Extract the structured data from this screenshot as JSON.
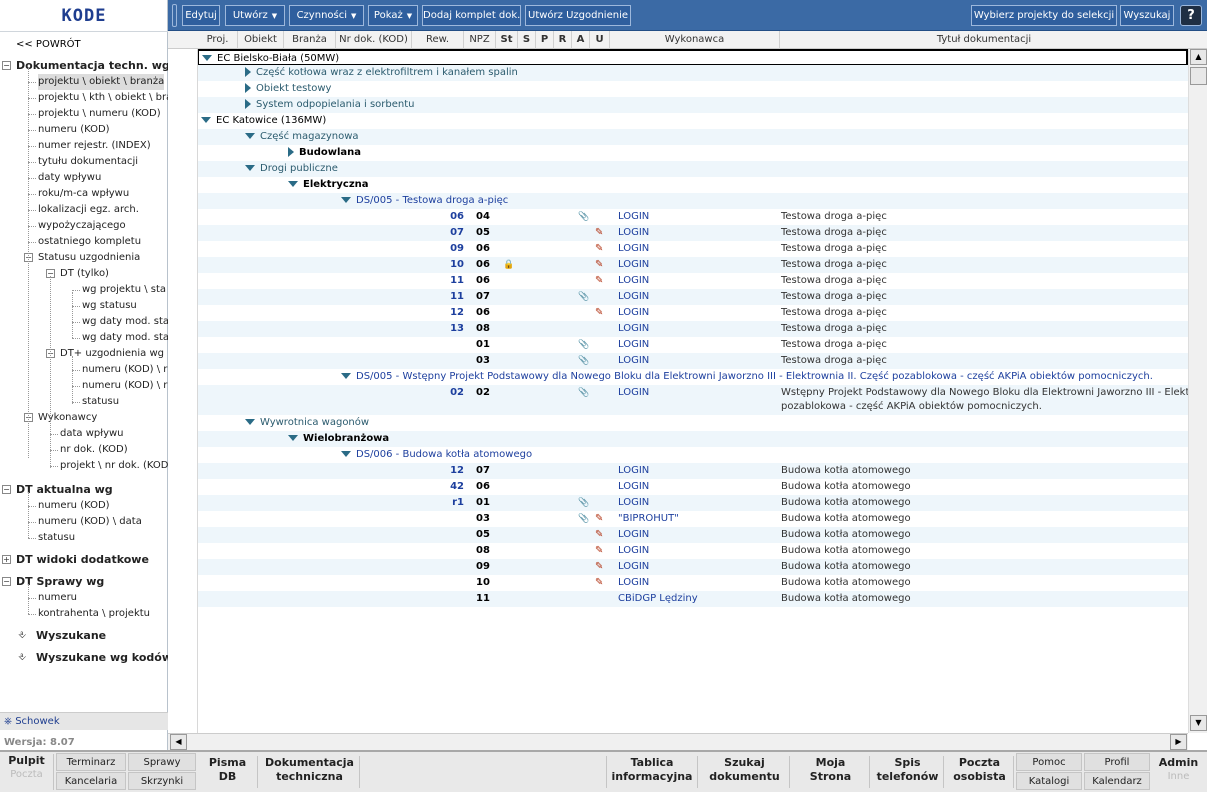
{
  "app": {
    "logo": "KODE",
    "back": "<< POWRÓT",
    "version": "Wersja: 8.07",
    "schowek": "Schowek"
  },
  "toolbar": {
    "edit": "Edytuj",
    "create": "Utwórz",
    "actions": "Czynności",
    "show": "Pokaż",
    "add_set": "Dodaj komplet dok.",
    "create_agreement": "Utwórz Uzgodnienie",
    "select_projects": "Wybierz projekty do selekcji",
    "search": "Wyszukaj",
    "help": "?"
  },
  "columns": {
    "proj": "Proj.",
    "obiekt": "Obiekt",
    "branza": "Branża",
    "nr_dok": "Nr dok. (KOD)",
    "rew": "Rew.",
    "npz": "NPZ",
    "st": "St",
    "s": "S",
    "p": "P",
    "r": "R",
    "a": "A",
    "u": "U",
    "wykonawca": "Wykonawca",
    "tytul": "Tytuł dokumentacji"
  },
  "sidebar": {
    "t0": "Dokumentacja techn. wg",
    "t1": "projektu \\ obiekt \\ branża",
    "t2": "projektu \\ kth \\ obiekt \\ bra",
    "t3": "projektu \\ numeru (KOD)",
    "t4": "numeru (KOD)",
    "t5": "numer rejestr. (INDEX)",
    "t6": "tytułu dokumentacji",
    "t7": "daty wpływu",
    "t8": "roku/m-ca wpływu",
    "t9": "lokalizacji egz. arch.",
    "t10": "wypożyczającego",
    "t11": "ostatniego kompletu",
    "t12": "Statusu uzgodnienia",
    "t13": "DT (tylko)",
    "t14": "wg projektu \\ sta",
    "t15": "wg statusu",
    "t16": "wg daty mod. sta",
    "t17": "wg daty mod. sta",
    "t18": "DT+ uzgodnienia wg",
    "t19": "numeru (KOD) \\ r",
    "t20": "numeru (KOD) \\ r",
    "t21": "statusu",
    "t22": "Wykonawcy",
    "t23": "data wpływu",
    "t24": "nr dok. (KOD)",
    "t25": "projekt \\ nr dok. (KOD",
    "t26": "DT aktualna wg",
    "t27": "numeru (KOD)",
    "t28": "numeru (KOD) \\ data",
    "t29": "statusu",
    "t30": "DT widoki dodatkowe",
    "t31": "DT Sprawy wg",
    "t32": "numeru",
    "t33": "kontrahenta \\ projektu",
    "t34": "Wyszukane",
    "t35": "Wyszukane wg kodów"
  },
  "tree": {
    "g1": "EC Bielsko-Biała (50MW)",
    "g1a": "Część kotłowa wraz z elektrofiltrem i kanałem spalin",
    "g1b": "Obiekt testowy",
    "g1c": "System odpopielania i sorbentu",
    "g2": "EC Katowice (136MW)",
    "g2a": "Część magazynowa",
    "g2a1": "Budowlana",
    "g2b": "Drogi publiczne",
    "g2b1": "Elektryczna",
    "d1": "DS/005 - Testowa droga a-pięc",
    "d2": "DS/005 - Wstępny Projekt Podstawowy dla Nowego Bloku dla Elektrowni Jaworzno III - Elektrownia II. Część pozablokowa - część AKPiA obiektów pomocniczych.",
    "g2c": "Wywrotnica wagonów",
    "g2c1": "Wielobranżowa",
    "d3": "DS/006 - Budowa kotła atomowego"
  },
  "docs1": [
    {
      "proj": "06",
      "rew": "04",
      "att": true,
      "edit": false,
      "lock": false,
      "wyk": "LOGIN",
      "tyt": "Testowa droga a-pięc"
    },
    {
      "proj": "07",
      "rew": "05",
      "att": false,
      "edit": true,
      "lock": false,
      "wyk": "LOGIN",
      "tyt": "Testowa droga a-pięc"
    },
    {
      "proj": "09",
      "rew": "06",
      "att": false,
      "edit": true,
      "lock": false,
      "wyk": "LOGIN",
      "tyt": "Testowa droga a-pięc"
    },
    {
      "proj": "10",
      "rew": "06",
      "att": false,
      "edit": true,
      "lock": true,
      "wyk": "LOGIN",
      "tyt": "Testowa droga a-pięc"
    },
    {
      "proj": "11",
      "rew": "06",
      "att": false,
      "edit": true,
      "lock": false,
      "wyk": "LOGIN",
      "tyt": "Testowa droga a-pięc"
    },
    {
      "proj": "11",
      "rew": "07",
      "att": true,
      "edit": false,
      "lock": false,
      "wyk": "LOGIN",
      "tyt": "Testowa droga a-pięc"
    },
    {
      "proj": "12",
      "rew": "06",
      "att": false,
      "edit": true,
      "lock": false,
      "wyk": "LOGIN",
      "tyt": "Testowa droga a-pięc"
    },
    {
      "proj": "13",
      "rew": "08",
      "att": false,
      "edit": false,
      "lock": false,
      "wyk": "LOGIN",
      "tyt": "Testowa droga a-pięc"
    },
    {
      "proj": "",
      "rew": "01",
      "att": true,
      "edit": false,
      "lock": false,
      "wyk": "LOGIN",
      "tyt": "Testowa droga a-pięc"
    },
    {
      "proj": "",
      "rew": "03",
      "att": true,
      "edit": false,
      "lock": false,
      "wyk": "LOGIN",
      "tyt": "Testowa droga a-pięc"
    }
  ],
  "docs2": {
    "proj": "02",
    "rew": "02",
    "wyk": "LOGIN",
    "tyt1": "Wstępny Projekt Podstawowy dla Nowego Bloku dla Elektrowni Jaworzno III - Elektr",
    "tyt2": "pozablokowa - część AKPiA obiektów pomocniczych."
  },
  "docs3": [
    {
      "proj": "12",
      "rew": "07",
      "att": false,
      "edit": false,
      "wyk": "LOGIN",
      "tyt": "Budowa kotła atomowego"
    },
    {
      "proj": "42",
      "rew": "06",
      "att": false,
      "edit": false,
      "wyk": "LOGIN",
      "tyt": "Budowa kotła atomowego"
    },
    {
      "proj": "r1",
      "rew": "01",
      "att": true,
      "edit": false,
      "wyk": "LOGIN",
      "tyt": "Budowa kotła atomowego"
    },
    {
      "proj": "",
      "rew": "03",
      "att": true,
      "edit": true,
      "wyk": "\"BIPROHUT\"",
      "tyt": "Budowa kotła atomowego"
    },
    {
      "proj": "",
      "rew": "05",
      "att": false,
      "edit": true,
      "wyk": "LOGIN",
      "tyt": "Budowa kotła atomowego"
    },
    {
      "proj": "",
      "rew": "08",
      "att": false,
      "edit": true,
      "wyk": "LOGIN",
      "tyt": "Budowa kotła atomowego"
    },
    {
      "proj": "",
      "rew": "09",
      "att": false,
      "edit": true,
      "wyk": "LOGIN",
      "tyt": "Budowa kotła atomowego"
    },
    {
      "proj": "",
      "rew": "10",
      "att": false,
      "edit": true,
      "wyk": "LOGIN",
      "tyt": "Budowa kotła atomowego"
    },
    {
      "proj": "",
      "rew": "11",
      "att": false,
      "edit": false,
      "wyk": "CBiDGP Lędziny",
      "tyt": "Budowa kotła atomowego"
    }
  ],
  "bottom": {
    "pulpit": "Pulpit",
    "pulpit_sub": "Poczta",
    "terminarz": "Terminarz",
    "kancelaria": "Kancelaria",
    "sprawy": "Sprawy",
    "skrzynki": "Skrzynki",
    "pisma1": "Pisma",
    "pisma2": "DB",
    "dok1": "Dokumentacja",
    "dok2": "techniczna",
    "tab1": "Tablica",
    "tab2": "informacyjna",
    "szu1": "Szukaj",
    "szu2": "dokumentu",
    "moja1": "Moja",
    "moja2": "Strona",
    "spis1": "Spis",
    "spis2": "telefonów",
    "pocz1": "Poczta",
    "pocz2": "osobista",
    "pomoc": "Pomoc",
    "katalogi": "Katalogi",
    "profil": "Profil",
    "kalendarz": "Kalendarz",
    "admin": "Admin",
    "admin_sub": "Inne"
  }
}
